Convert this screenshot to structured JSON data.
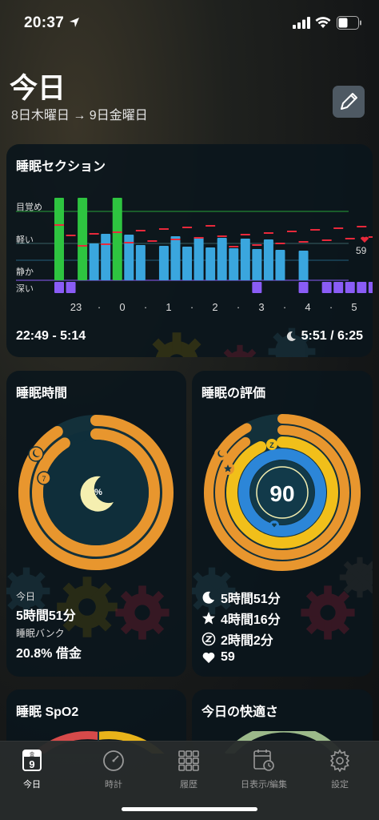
{
  "status_bar": {
    "time": "20:37"
  },
  "header": {
    "title": "今日",
    "subtitle": "8日木曜日 → 9日金曜日"
  },
  "sleep_section": {
    "title": "睡眠セクション",
    "y_labels": [
      "目覚め",
      "軽い",
      "静か",
      "深い"
    ],
    "x_labels": [
      "23",
      "·",
      "0",
      "·",
      "1",
      "·",
      "2",
      "·",
      "3",
      "·",
      "4",
      "·",
      "5"
    ],
    "time_range": "22:49 - 5:14",
    "duration_ratio": "5:51 / 6:25",
    "heart_rate_value": "59",
    "colors": {
      "awake": "#2ec440",
      "light": "#3aa6de",
      "deep": "#8a5cf6",
      "marker": "#e8293b"
    },
    "chart_data": {
      "type": "bar",
      "x": [
        0,
        1,
        2,
        3,
        4,
        5,
        6,
        7,
        8,
        9,
        10,
        11,
        12,
        13,
        14,
        15,
        16,
        17,
        18,
        19,
        20,
        21,
        22,
        23,
        24,
        25,
        26,
        27,
        28,
        29,
        30,
        31,
        32,
        33,
        34,
        35,
        36,
        37,
        38,
        39
      ],
      "stage": [
        "awake",
        "none",
        "awake",
        "light",
        "light",
        "awake",
        "light",
        "light",
        "none",
        "light",
        "light",
        "light",
        "light",
        "light",
        "light",
        "light",
        "light",
        "light",
        "light",
        "light",
        "none",
        "light",
        "none",
        "none",
        "none",
        "none",
        "none",
        "none",
        "none",
        "light",
        "light",
        "light",
        "light",
        "none",
        "none",
        "none",
        "none",
        "none",
        "none",
        "none"
      ],
      "deep_segments": [
        1,
        1,
        0,
        0,
        0,
        0,
        0,
        0,
        0,
        0,
        0,
        0,
        0,
        0,
        0,
        0,
        0,
        1,
        0,
        0,
        0,
        0,
        0,
        0,
        0,
        0,
        0,
        0,
        0,
        0,
        0,
        0,
        0,
        0,
        0,
        0,
        0,
        0,
        0,
        0
      ],
      "heart_marker_value": 59
    }
  },
  "sleep_time": {
    "title": "睡眠時間",
    "moon_badge": "%",
    "small_badge": "7",
    "today_label": "今日",
    "today_value": "5時間51分",
    "bank_label": "睡眠バンク",
    "bank_value": "20.8% 借金",
    "colors": {
      "ring": "#e8962e",
      "ring_track": "#1b3a44",
      "inner": "#0f2e3a",
      "moon": "#f5efb0"
    },
    "progress": {
      "outer": 0.91,
      "inner": 0.91
    }
  },
  "sleep_score": {
    "title": "睡眠の評価",
    "score": "90",
    "z_badge": "Z",
    "rows": [
      {
        "icon": "moon-icon",
        "value": "5時間51分"
      },
      {
        "icon": "star-icon",
        "value": "4時間16分"
      },
      {
        "icon": "zzz-icon",
        "value": "2時間2分"
      },
      {
        "icon": "heart-icon",
        "value": "59"
      }
    ],
    "colors": {
      "outer": "#e8962e",
      "middle": "#f1bf1a",
      "inner": "#2c86d8",
      "center": "#123a4a"
    }
  },
  "spo2": {
    "title": "睡眠 SpO2"
  },
  "comfort": {
    "title": "今日の快適さ"
  },
  "tab_bar": {
    "tabs": [
      {
        "label": "今日",
        "icon": "calendar-day-icon",
        "badge": "9",
        "badge_top": "金",
        "active": true
      },
      {
        "label": "時計",
        "icon": "clock-icon",
        "active": false
      },
      {
        "label": "履歴",
        "icon": "grid-icon",
        "active": false
      },
      {
        "label": "日表示/編集",
        "icon": "calendar-clock-icon",
        "active": false
      },
      {
        "label": "設定",
        "icon": "gear-icon",
        "active": false
      }
    ]
  }
}
